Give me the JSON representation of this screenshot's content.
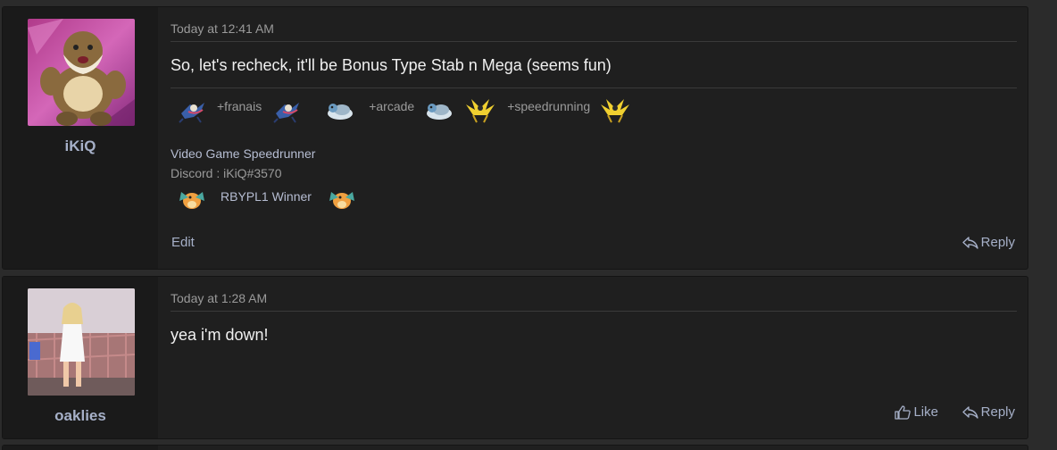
{
  "posts": [
    {
      "username": "iKiQ",
      "date": "Today at 12:41 AM",
      "message": "So, let's recheck, it'll be Bonus Type Stab n Mega (seems fun)",
      "badges": [
        "+franais",
        "+arcade",
        "+speedrunning"
      ],
      "signature_title": "Video Game Speedrunner",
      "signature_discord": "Discord : iKiQ#3570",
      "award": "RBYPL1 Winner",
      "actions": {
        "edit": "Edit",
        "reply": "Reply"
      }
    },
    {
      "username": "oaklies",
      "date": "Today at 1:28 AM",
      "message": "yea i'm down!",
      "actions": {
        "like": "Like",
        "reply": "Reply"
      }
    }
  ],
  "icons": {
    "badge_sprites": [
      "greninja-icon",
      "lapras-icon",
      "zapdos-icon"
    ],
    "award_sprite": "dragonite-icon",
    "reply": "reply-arrow-icon",
    "like": "thumbs-up-icon"
  }
}
